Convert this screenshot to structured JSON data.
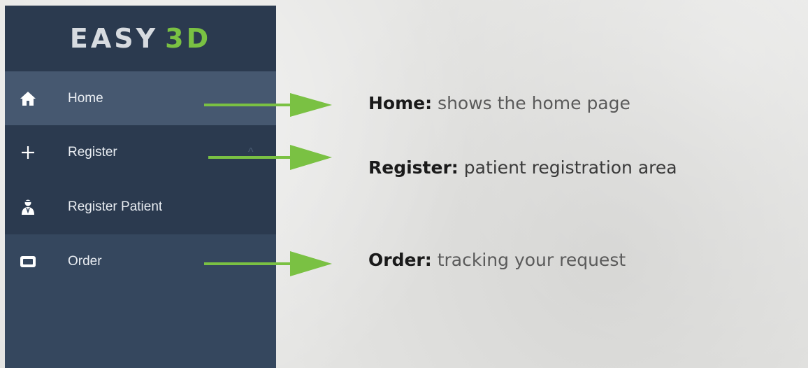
{
  "logo": {
    "part1": "EASY",
    "part2": "3D"
  },
  "nav": [
    {
      "label": "Home",
      "icon": "home-icon"
    },
    {
      "label": "Register",
      "icon": "plus-icon"
    },
    {
      "label": "Register Patient",
      "icon": "patient-icon"
    },
    {
      "label": "Order",
      "icon": "order-icon"
    }
  ],
  "annotations": [
    {
      "term": "Home:",
      "desc": "shows the home page"
    },
    {
      "term": "Register:",
      "desc": "patient registration area"
    },
    {
      "term": "Order:",
      "desc": "tracking your request"
    }
  ],
  "colors": {
    "sidebar": "#35475e",
    "active": "#465870",
    "accent_green": "#7ac143"
  }
}
